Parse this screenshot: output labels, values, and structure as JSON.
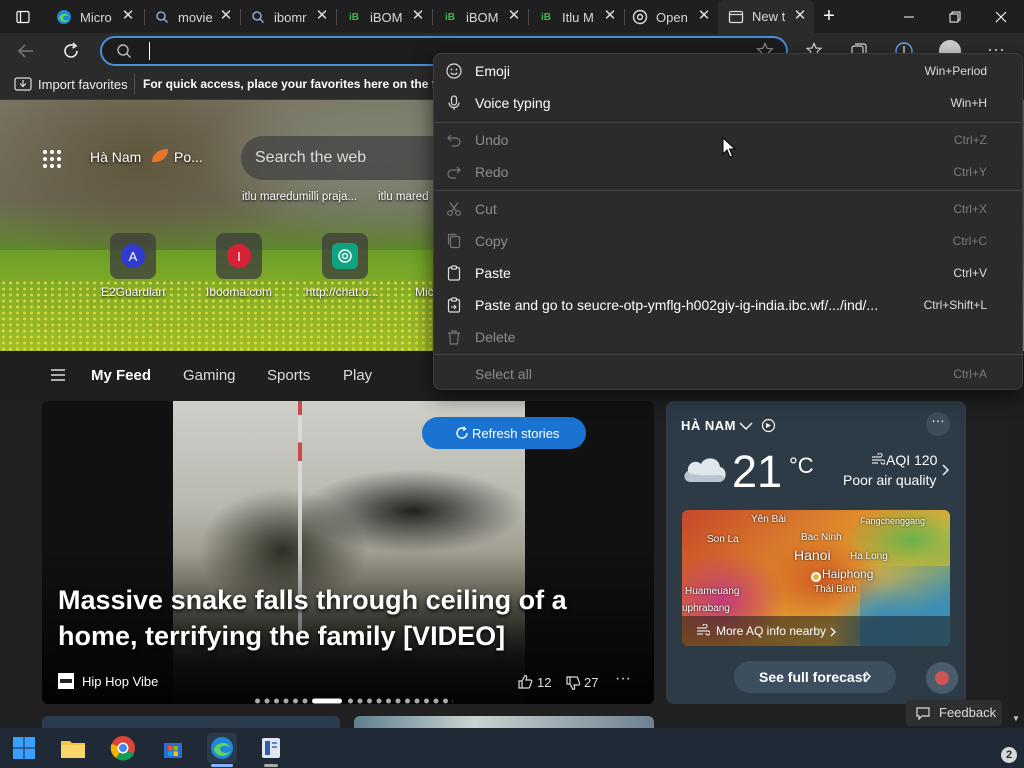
{
  "tabs": [
    {
      "label": "Micro",
      "icon": "edge-icon"
    },
    {
      "label": "movie",
      "icon": "search-icon"
    },
    {
      "label": "ibomr",
      "icon": "search-icon"
    },
    {
      "label": "iBOM",
      "icon": "ibom-icon"
    },
    {
      "label": "iBOM",
      "icon": "ibom-icon"
    },
    {
      "label": "Itlu M",
      "icon": "ibom-icon"
    },
    {
      "label": "Open",
      "icon": "openai-icon"
    },
    {
      "label": "New t",
      "icon": "newtab-icon",
      "active": true
    }
  ],
  "address_bar": {
    "value": ""
  },
  "favorites_bar": {
    "import_label": "Import favorites",
    "hint": "For quick access, place your favorites here on the favo"
  },
  "hero": {
    "location": "Hà Nam",
    "weather_short": "Po...",
    "search_placeholder": "Search the web",
    "suggestions": [
      "itlu maredumilli praja...",
      "itlu mared"
    ],
    "quick_links": [
      {
        "label": "E2Guardian",
        "letter": "A",
        "color": "#2f3bd1"
      },
      {
        "label": "Ibooma.com",
        "letter": "I",
        "color": "#d62139"
      },
      {
        "label": "http://chat.o...",
        "letter": "",
        "color": "#10a37f"
      },
      {
        "label": "Mic",
        "letter": "",
        "color": ""
      }
    ]
  },
  "feed_nav": {
    "items": [
      "My Feed",
      "Gaming",
      "Sports",
      "Play"
    ],
    "active": "My Feed"
  },
  "story": {
    "refresh_label": "Refresh stories",
    "headline": "Massive snake falls through ceiling of a home, terrifying the family [VIDEO]",
    "source": "Hip Hop Vibe",
    "likes": "12",
    "dislikes": "27",
    "carousel_count": 20,
    "carousel_active": 6
  },
  "weather": {
    "location": "HÀ NAM",
    "temp": "21",
    "unit": "°C",
    "aqi": "AQI 120",
    "aq_status": "Poor air quality",
    "map_labels": [
      "Yên Bái",
      "Fangchenggang",
      "Son La",
      "Bac Ninh",
      "Hanoi",
      "Ha Long",
      "Haiphong",
      "Huameuang",
      "Thái Bình",
      "uphrabang"
    ],
    "more_aq": "More AQ info nearby",
    "forecast_btn": "See full forecast"
  },
  "feedback_label": "Feedback",
  "context_menu": {
    "items": [
      {
        "label": "Emoji",
        "key": "Win+Period",
        "icon": "emoji-icon",
        "enabled": true
      },
      {
        "label": "Voice typing",
        "key": "Win+H",
        "icon": "microphone-icon",
        "enabled": true
      },
      {
        "label": "Undo",
        "key": "Ctrl+Z",
        "icon": "undo-icon",
        "enabled": false
      },
      {
        "label": "Redo",
        "key": "Ctrl+Y",
        "icon": "redo-icon",
        "enabled": false
      },
      {
        "label": "Cut",
        "key": "Ctrl+X",
        "icon": "scissors-icon",
        "enabled": false
      },
      {
        "label": "Copy",
        "key": "Ctrl+C",
        "icon": "copy-icon",
        "enabled": false
      },
      {
        "label": "Paste",
        "key": "Ctrl+V",
        "icon": "clipboard-icon",
        "enabled": true
      },
      {
        "label": "Paste and go to seucre-otp-ymflg-h002giy-ig-india.ibc.wf/.../ind/...",
        "key": "Ctrl+Shift+L",
        "icon": "clipboard-go-icon",
        "enabled": true
      },
      {
        "label": "Delete",
        "key": "",
        "icon": "trash-icon",
        "enabled": false
      },
      {
        "label": "Select all",
        "key": "Ctrl+A",
        "icon": "",
        "enabled": false
      }
    ]
  },
  "taskbar": {
    "notification_count": "2"
  },
  "colors": {
    "accent": "#4a90d9",
    "refresh_btn": "#1a73d1",
    "weather_card": "#2d3b47"
  }
}
